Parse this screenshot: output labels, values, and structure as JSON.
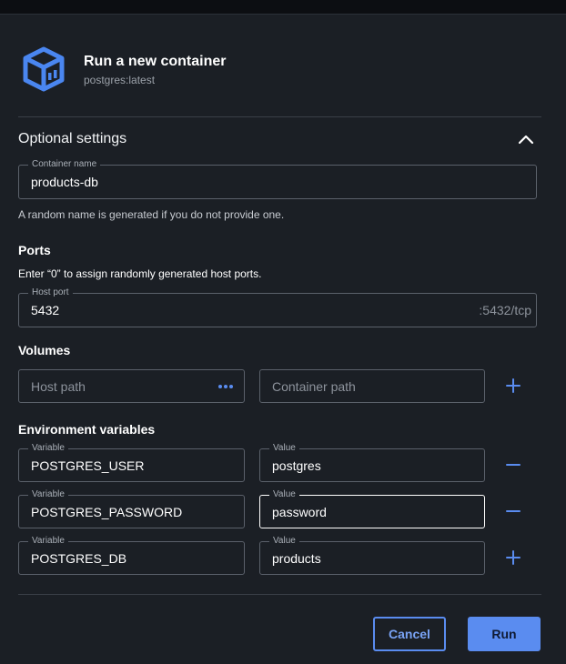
{
  "header": {
    "title": "Run a new container",
    "image": "postgres:latest",
    "icon": "docker-container-icon"
  },
  "optional_settings": {
    "title": "Optional settings",
    "collapse_icon": "chevron-up-icon",
    "container_name": {
      "label": "Container name",
      "value": "products-db",
      "help": "A random name is generated if you do not provide one."
    }
  },
  "ports": {
    "title": "Ports",
    "help": "Enter “0” to assign randomly generated host ports.",
    "host_port": {
      "label": "Host port",
      "value": "5432",
      "suffix": ":5432/tcp"
    }
  },
  "volumes": {
    "title": "Volumes",
    "host_path_placeholder": "Host path",
    "container_path_placeholder": "Container path",
    "add_icon": "plus-icon"
  },
  "env": {
    "title": "Environment variables",
    "variable_label": "Variable",
    "value_label": "Value",
    "rows": [
      {
        "variable": "POSTGRES_USER",
        "value": "postgres",
        "action": "minus-icon"
      },
      {
        "variable": "POSTGRES_PASSWORD",
        "value": "password",
        "action": "minus-icon"
      },
      {
        "variable": "POSTGRES_DB",
        "value": "products",
        "action": "plus-icon"
      }
    ]
  },
  "footer": {
    "cancel_label": "Cancel",
    "run_label": "Run"
  },
  "colors": {
    "accent": "#5a8cf0",
    "background": "#1b1f25",
    "border": "#5b616b"
  }
}
